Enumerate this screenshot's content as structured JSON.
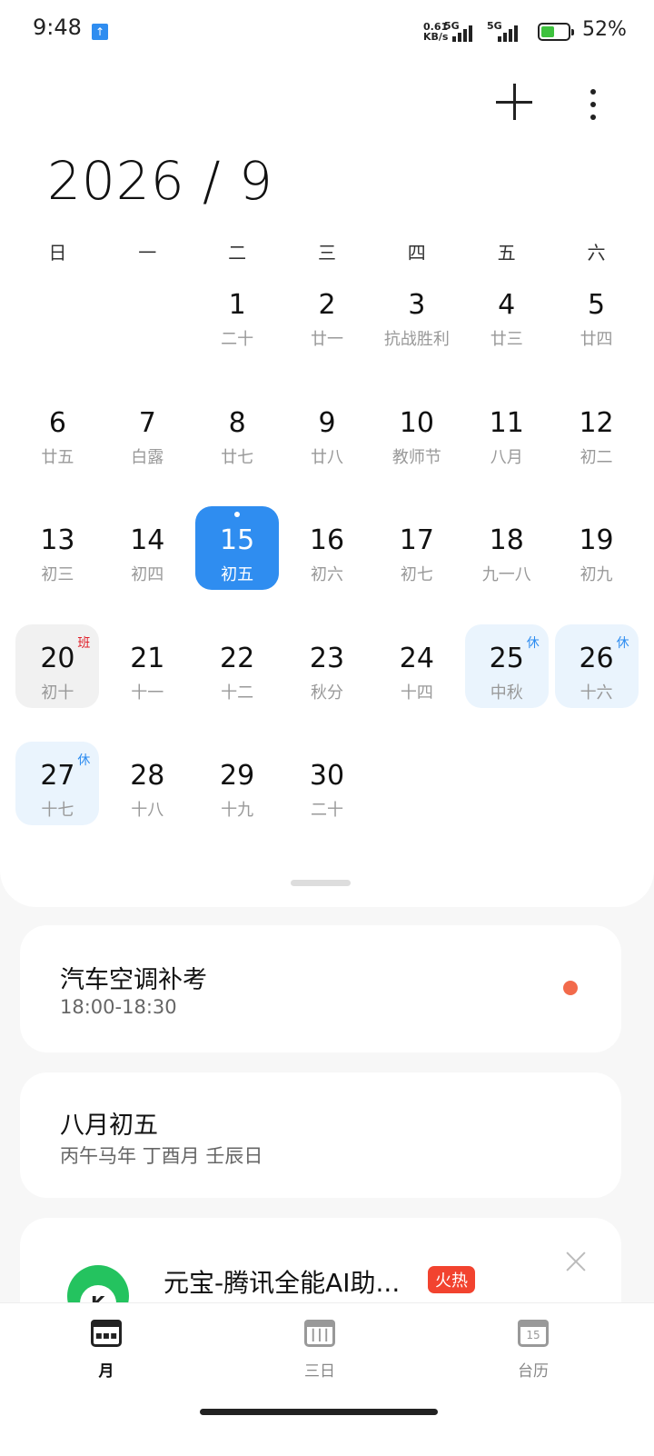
{
  "status_bar": {
    "time": "9:48",
    "net_speed_top": "0.61",
    "net_speed_unit": "KB/s",
    "signal1": "5G",
    "signal2": "5G",
    "battery_percent": "52%",
    "battery_level": 0.52,
    "upload_badge_icon": "upload-arrow-icon"
  },
  "header": {
    "add_icon": "plus-icon",
    "more_icon": "more-vertical-icon",
    "month_title": "2026 / 9"
  },
  "weekdays": [
    "日",
    "一",
    "二",
    "三",
    "四",
    "五",
    "六"
  ],
  "days": [
    {
      "num": "1",
      "lunar": "二十"
    },
    {
      "num": "2",
      "lunar": "廿一"
    },
    {
      "num": "3",
      "lunar": "抗战胜利"
    },
    {
      "num": "4",
      "lunar": "廿三"
    },
    {
      "num": "5",
      "lunar": "廿四"
    },
    {
      "num": "6",
      "lunar": "廿五"
    },
    {
      "num": "7",
      "lunar": "白露"
    },
    {
      "num": "8",
      "lunar": "廿七"
    },
    {
      "num": "9",
      "lunar": "廿八"
    },
    {
      "num": "10",
      "lunar": "教师节"
    },
    {
      "num": "11",
      "lunar": "八月"
    },
    {
      "num": "12",
      "lunar": "初二"
    },
    {
      "num": "13",
      "lunar": "初三"
    },
    {
      "num": "14",
      "lunar": "初四"
    },
    {
      "num": "15",
      "lunar": "初五",
      "state": "today"
    },
    {
      "num": "16",
      "lunar": "初六"
    },
    {
      "num": "17",
      "lunar": "初七"
    },
    {
      "num": "18",
      "lunar": "九一八"
    },
    {
      "num": "19",
      "lunar": "初九"
    },
    {
      "num": "20",
      "lunar": "初十",
      "state": "workday",
      "badge": "班"
    },
    {
      "num": "21",
      "lunar": "十一"
    },
    {
      "num": "22",
      "lunar": "十二"
    },
    {
      "num": "23",
      "lunar": "秋分"
    },
    {
      "num": "24",
      "lunar": "十四"
    },
    {
      "num": "25",
      "lunar": "中秋",
      "state": "holiday",
      "badge": "休"
    },
    {
      "num": "26",
      "lunar": "十六",
      "state": "holiday",
      "badge": "休"
    },
    {
      "num": "27",
      "lunar": "十七",
      "state": "holiday",
      "badge": "休"
    },
    {
      "num": "28",
      "lunar": "十八"
    },
    {
      "num": "29",
      "lunar": "十九"
    },
    {
      "num": "30",
      "lunar": "二十"
    }
  ],
  "event": {
    "title": "汽车空调补考",
    "time": "18:00-18:30",
    "dot_color": "#f26a4b"
  },
  "lunar_info": {
    "title": "八月初五",
    "subtitle": "丙午马年 丁酉月 壬辰日"
  },
  "ad": {
    "title": "元宝-腾讯全能AI助...",
    "badge": "火热",
    "close_icon": "close-icon"
  },
  "bottom_nav": {
    "tabs": [
      {
        "label": "月",
        "icon": "month-view-icon",
        "active": true
      },
      {
        "label": "三日",
        "icon": "three-day-icon",
        "active": false
      },
      {
        "label": "台历",
        "icon": "desk-calendar-icon",
        "active": false,
        "glyph": "15"
      }
    ]
  },
  "colors": {
    "accent": "#2f8df0",
    "workday_badge": "#e0202a",
    "holiday_bg": "#eaf4fd"
  }
}
